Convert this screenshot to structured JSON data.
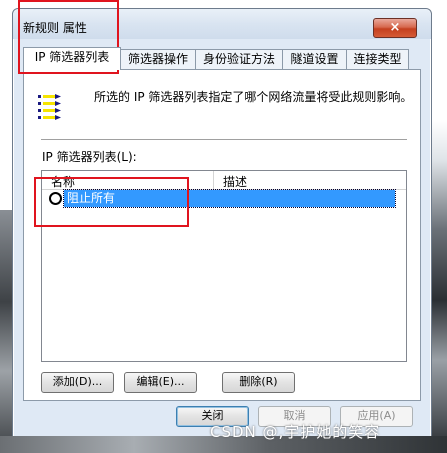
{
  "window": {
    "title": "新规则 属性",
    "close_glyph": "×"
  },
  "tabs": [
    {
      "label": "IP 筛选器列表",
      "active": true
    },
    {
      "label": "筛选器操作",
      "active": false
    },
    {
      "label": "身份验证方法",
      "active": false
    },
    {
      "label": "隧道设置",
      "active": false
    },
    {
      "label": "连接类型",
      "active": false
    }
  ],
  "panel": {
    "icon": "filter-list-icon",
    "description": "所选的 IP 筛选器列表指定了哪个网络流量将受此规则影响。",
    "list_label": "IP 筛选器列表(L):",
    "columns": [
      "名称",
      "描述"
    ],
    "rows": [
      {
        "name": "阻止所有",
        "description": "",
        "selected": true
      }
    ],
    "buttons": {
      "add": "添加(D)...",
      "edit": "编辑(E)...",
      "delete": "删除(R)"
    }
  },
  "footer": {
    "close": "关闭",
    "cancel": "取消",
    "apply": "应用(A)"
  },
  "watermark": "CSDN @,宇护她的笑容",
  "colors": {
    "selection": "#3399ff",
    "annotation": "#e0141e",
    "close_button": "#c4401f"
  }
}
